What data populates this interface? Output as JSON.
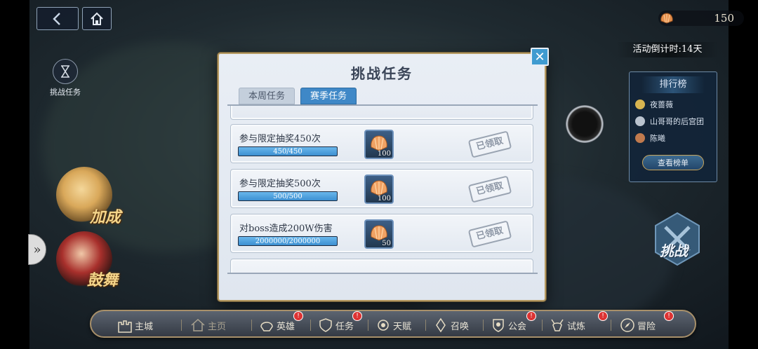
{
  "topbar": {
    "back_icon": "back-arrow-icon",
    "home_icon": "home-icon",
    "currency_value": "150",
    "currency_icon": "shell-icon"
  },
  "side": {
    "challenge_tasks_label": "挑战任务"
  },
  "countdown": "活动倒计时:14天",
  "ranking": {
    "title": "排行榜",
    "entries": [
      "夜蔷薇",
      "山哥哥的后宫团",
      "陈曦"
    ],
    "view_button": "查看榜单"
  },
  "characters": {
    "bonus_label": "加成",
    "dance_label": "鼓舞"
  },
  "challenge_badge_label": "挑战",
  "modal": {
    "title": "挑战任务",
    "tabs": [
      {
        "label": "本周任务",
        "active": false
      },
      {
        "label": "赛季任务",
        "active": true
      }
    ],
    "tasks": [
      {
        "name": "参与限定抽奖450次",
        "progress_text": "450/450",
        "progress": 1.0,
        "reward_qty": "100",
        "status": "已领取"
      },
      {
        "name": "参与限定抽奖500次",
        "progress_text": "500/500",
        "progress": 1.0,
        "reward_qty": "100",
        "status": "已领取"
      },
      {
        "name": "对boss造成200W伤害",
        "progress_text": "2000000/2000000",
        "progress": 1.0,
        "reward_qty": "50",
        "status": "已领取"
      }
    ]
  },
  "bottom_nav": {
    "items": [
      {
        "label": "主城",
        "badge": ""
      },
      {
        "label": "主页",
        "badge": ""
      },
      {
        "label": "英雄",
        "badge": "!"
      },
      {
        "label": "任务",
        "badge": "!"
      },
      {
        "label": "天赋",
        "badge": ""
      },
      {
        "label": "召唤",
        "badge": ""
      },
      {
        "label": "公会",
        "badge": "!"
      },
      {
        "label": "试炼",
        "badge": "!"
      },
      {
        "label": "冒险",
        "badge": "!"
      }
    ]
  },
  "colors": {
    "accent_blue": "#3f88c7",
    "modal_bg": "#e6ecf3",
    "gold_border": "#b69a62",
    "badge_red": "#dd3333"
  }
}
